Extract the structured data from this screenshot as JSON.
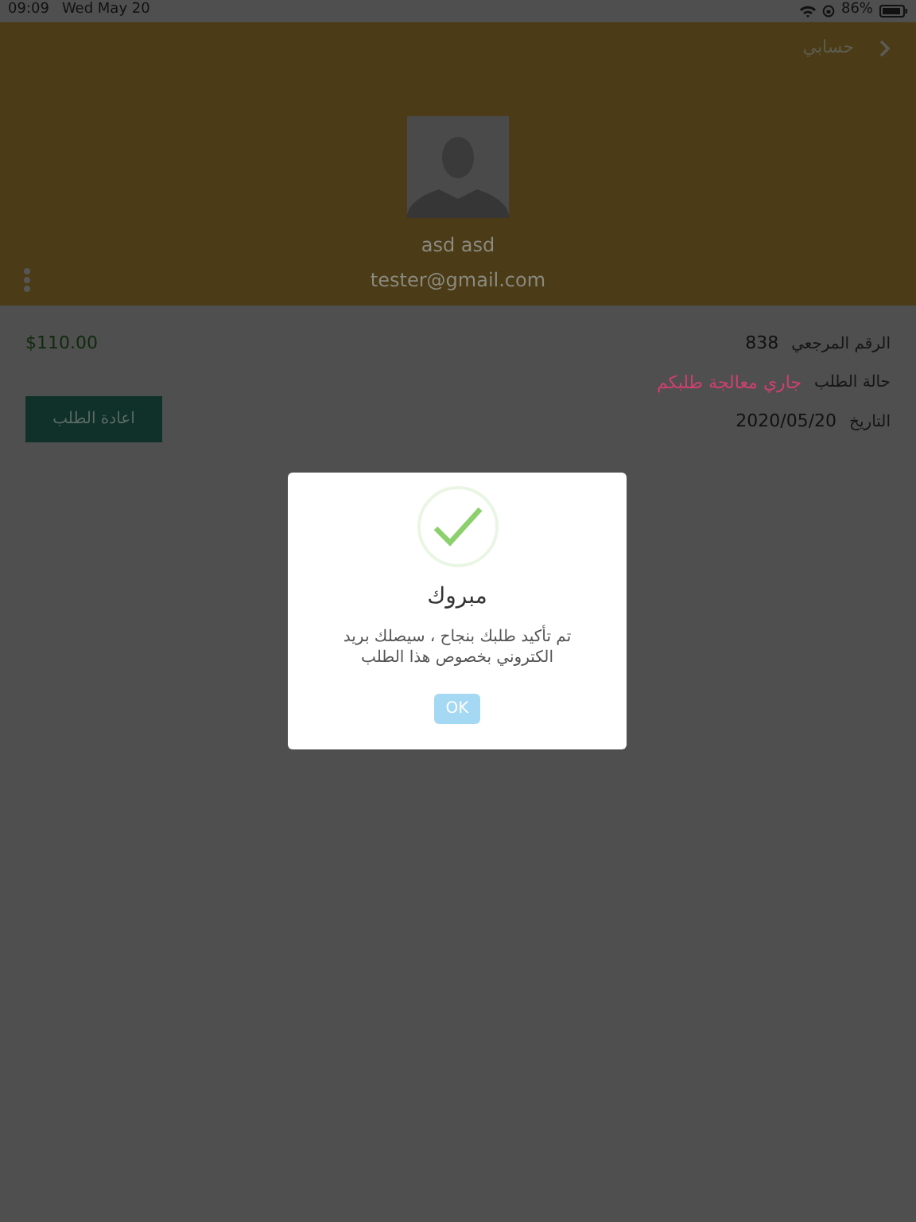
{
  "status_bar": {
    "time": "09:09",
    "date": "Wed May 20",
    "battery": "86%"
  },
  "header": {
    "title": "حسابي",
    "name": "asd asd",
    "email": "tester@gmail.com"
  },
  "order": {
    "fields": [
      {
        "label": "الرقم المرجعي",
        "value": "838",
        "kind": "plain"
      },
      {
        "label": "حالة الطلب",
        "value": "جاري معالجة طلبكم",
        "kind": "status"
      },
      {
        "label": "التاريخ",
        "value": "2020/05/20",
        "kind": "plain"
      }
    ],
    "price": "$110.00",
    "reorder_button": "اعادة الطلب"
  },
  "dialog": {
    "title": "مبروك",
    "message": "تم تأكيد طلبك بنجاح ، سيصلك بريد الكتروني بخصوص هذا الطلب",
    "button": "OK"
  }
}
